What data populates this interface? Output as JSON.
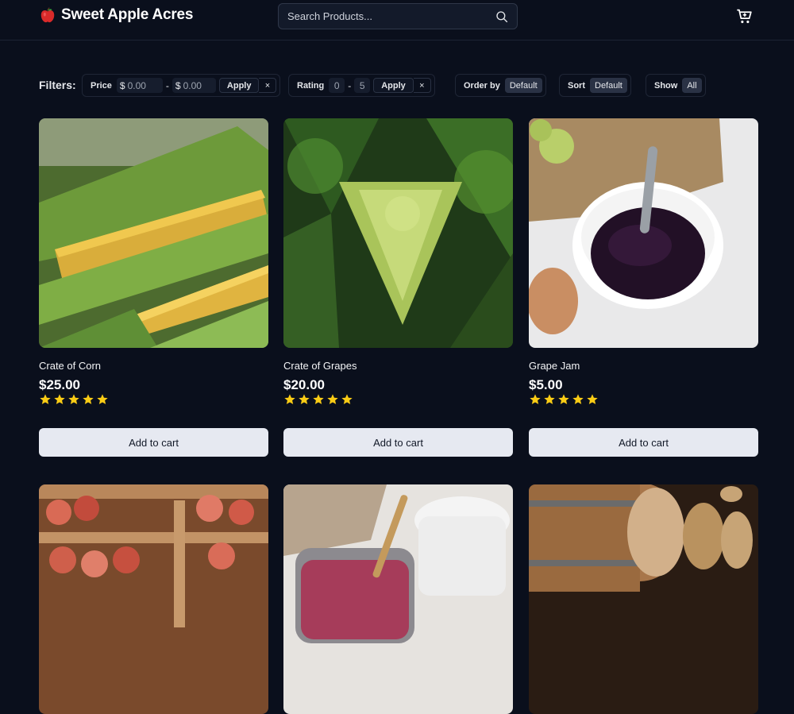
{
  "brand": {
    "name": "Sweet Apple Acres",
    "icon": "apple-icon",
    "icon_color": "#d92a2a"
  },
  "search": {
    "placeholder": "Search Products..."
  },
  "cart": {
    "icon": "cart-icon"
  },
  "filters": {
    "label": "Filters:",
    "price": {
      "label": "Price",
      "currency": "$",
      "min": "0.00",
      "max": "0.00",
      "separator": "-",
      "apply": "Apply",
      "clear": "×"
    },
    "rating": {
      "label": "Rating",
      "min": "0",
      "max": "5",
      "separator": "-",
      "apply": "Apply",
      "clear": "×"
    },
    "order_by": {
      "label": "Order by",
      "value": "Default"
    },
    "sort": {
      "label": "Sort",
      "value": "Default"
    },
    "show": {
      "label": "Show",
      "value": "All"
    }
  },
  "products": [
    {
      "name": "Crate of Corn",
      "price": "$25.00",
      "rating": 5,
      "button": "Add to cart"
    },
    {
      "name": "Crate of Grapes",
      "price": "$20.00",
      "rating": 5,
      "button": "Add to cart"
    },
    {
      "name": "Grape Jam",
      "price": "$5.00",
      "rating": 5,
      "button": "Add to cart"
    },
    {
      "name": "",
      "price": "",
      "rating": 0,
      "button": ""
    },
    {
      "name": "",
      "price": "",
      "rating": 0,
      "button": ""
    },
    {
      "name": "",
      "price": "",
      "rating": 0,
      "button": ""
    }
  ],
  "colors": {
    "background": "#0a0f1c",
    "star": "#facc15",
    "button_bg": "#e6e9f1"
  }
}
